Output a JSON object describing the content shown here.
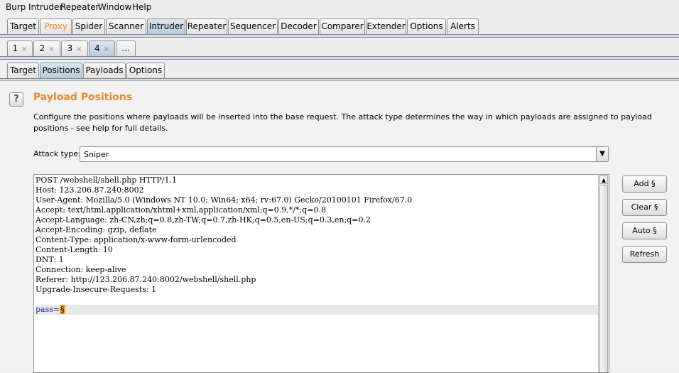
{
  "menubar": [
    "Burp",
    "Intruder",
    "Repeater",
    "Window",
    "Help"
  ],
  "main_tabs": [
    "Target",
    "Proxy",
    "Spider",
    "Scanner",
    "Intruder",
    "Repeater",
    "Sequencer",
    "Decoder",
    "Comparer",
    "Extender",
    "Options",
    "Alerts"
  ],
  "attack_tabs": [
    {
      "label": "1",
      "close": "×"
    },
    {
      "label": "2",
      "close": "×"
    },
    {
      "label": "3",
      "close": "×"
    },
    {
      "label": "4",
      "close": "×"
    },
    {
      "label": "...",
      "close": ""
    }
  ],
  "sub_tabs": [
    "Target",
    "Positions",
    "Payloads",
    "Options"
  ],
  "help_icon": "?",
  "section": {
    "title": "Payload Positions",
    "description": "Configure the positions where payloads will be inserted into the base request. The attack type determines the way in which payloads are assigned to payload positions - see help for full details."
  },
  "attack_type": {
    "label": "Attack type:",
    "value": "Sniper",
    "arrow": "▼"
  },
  "request_lines": [
    "POST /webshell/shell.php HTTP/1.1",
    "Host: 123.206.87.240:8002",
    "User-Agent: Mozilla/5.0 (Windows NT 10.0; Win64; x64; rv:67.0) Gecko/20100101 Firefox/67.0",
    "Accept: text/html,application/xhtml+xml,application/xml;q=0.9,*/*;q=0.8",
    "Accept-Language: zh-CN,zh;q=0.8,zh-TW;q=0.7,zh-HK;q=0.5,en-US;q=0.3,en;q=0.2",
    "Accept-Encoding: gzip, deflate",
    "Content-Type: application/x-www-form-urlencoded",
    "Content-Length: 10",
    "DNT: 1",
    "Connection: keep-alive",
    "Referer: http://123.206.87.240:8002/webshell/shell.php",
    "Upgrade-Insecure-Requests: 1",
    ""
  ],
  "body_line": {
    "key": "pass",
    "eq": "=",
    "marker": "§"
  },
  "buttons": {
    "add": "Add §",
    "clear": "Clear §",
    "auto": "Auto §",
    "refresh": "Refresh"
  },
  "colors": {
    "accent_orange": "#e8892a",
    "active_tab": "#b9cbdc",
    "param_blue": "#1d2a9c",
    "marker": "#f5a623"
  }
}
